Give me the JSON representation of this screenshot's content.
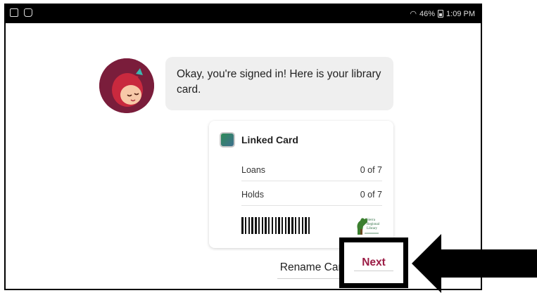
{
  "status_bar": {
    "signal_text": "46%",
    "time": "1:09 PM",
    "left_icons": [
      "gallery-icon",
      "bag-icon"
    ]
  },
  "chat": {
    "message": "Okay, you're signed in! Here is your library card."
  },
  "card": {
    "title": "Linked Card",
    "rows": [
      {
        "label": "Loans",
        "value": "0 of 7"
      },
      {
        "label": "Holds",
        "value": "0 of 7"
      }
    ],
    "barcode_icon": "barcode",
    "logo_text": [
      "Sierra",
      "Regional",
      "Library"
    ]
  },
  "buttons": {
    "rename": "Rename Card",
    "next": "Next"
  },
  "colors": {
    "accent": "#9b1c45",
    "avatar_bg": "#7a1d3b",
    "bubble_bg": "#efefef"
  },
  "annotation": {
    "arrow_icon": "left-arrow-icon",
    "highlight": "next-button-highlight"
  }
}
